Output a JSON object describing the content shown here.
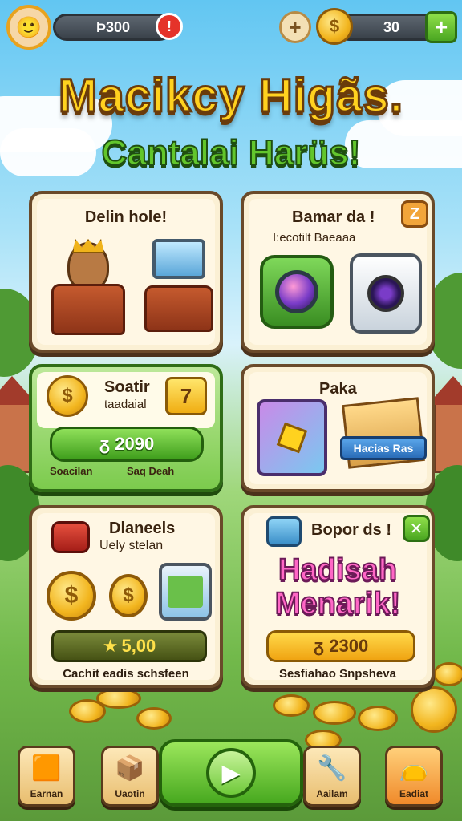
{
  "header": {
    "balance": "Þ300",
    "alert": "!",
    "coins": "30",
    "coin_symbol": "$",
    "plus": "+"
  },
  "title": {
    "line1": "Macikcy Higãs.",
    "line2": "Cantalai Harüs!"
  },
  "cards": [
    {
      "title": "Delin hole!"
    },
    {
      "title": "Bamar da !",
      "subtitle": "I:ecotilt Baeaaa",
      "badge": "Z"
    },
    {
      "title": "Soatir",
      "subtitle": "taadaial",
      "badge": "7",
      "price": "ᵹ 2090",
      "foot_left": "Soacilan",
      "foot_right": "Saq Deah"
    },
    {
      "title": "Paka",
      "ribbon": "Hacias Ras"
    },
    {
      "title": "Dlaneels",
      "subtitle": "Uely stelan",
      "price": "5,00",
      "foot": "Cachit eadis schsfeen"
    },
    {
      "title": "Bopor ds !",
      "promo_line1": "Hadisah",
      "promo_line2": "Menarik!",
      "badge": "✕",
      "price": "ᵹ 2300",
      "foot": "Sesfiahao Snpsheva"
    }
  ],
  "nav": {
    "items": [
      {
        "label": "Earnan",
        "icon": "card-icon"
      },
      {
        "label": "Uaotin",
        "icon": "chest-icon"
      },
      {
        "label": "Aailam",
        "icon": "wrench-icon"
      },
      {
        "label": "Eadiat",
        "icon": "bag-icon"
      }
    ],
    "play": "▶"
  },
  "colors": {
    "accent_green": "#4aa621",
    "gold": "#f2b51e",
    "card_bg": "#fbf0d4",
    "promo_pink": "#ff67c6"
  }
}
